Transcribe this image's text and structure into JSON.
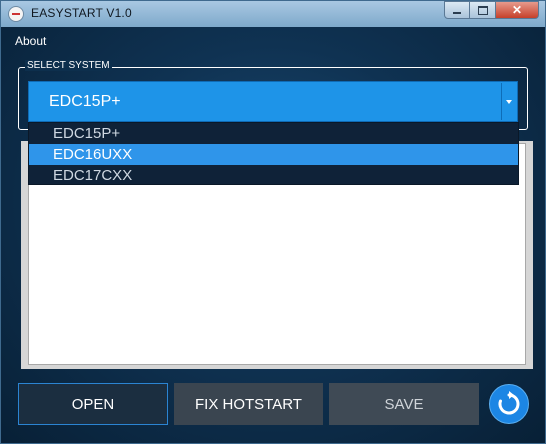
{
  "window": {
    "title": "EASYSTART  V1.0",
    "icons": {
      "app": "app-logo-icon",
      "minimize": "minimize-icon",
      "maximize": "maximize-icon",
      "close": "close-icon"
    }
  },
  "menu": {
    "about": "About"
  },
  "select_system": {
    "group_label": "SELECT SYSTEM",
    "value": "EDC15P+",
    "options": [
      "EDC15P+",
      "EDC16UXX",
      "EDC17CXX"
    ],
    "highlighted": "EDC16UXX"
  },
  "buttons": {
    "open": "OPEN",
    "fix_hotstart": "FIX HOTSTART",
    "save": "SAVE",
    "refresh_icon": "refresh-icon"
  },
  "colors": {
    "accent": "#1e94e8",
    "highlight": "#2f95ea",
    "background": "#0f3252"
  }
}
